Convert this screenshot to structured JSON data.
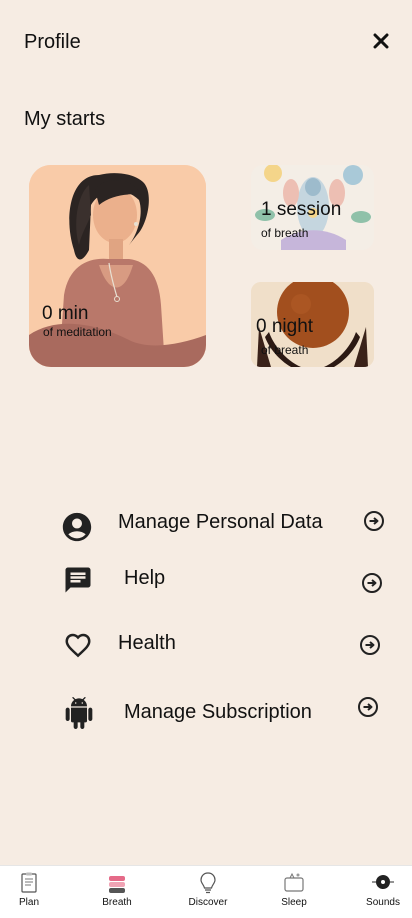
{
  "header": {
    "title": "Profile",
    "close_icon": "close-icon"
  },
  "stats_section": {
    "title": "My starts",
    "cards": [
      {
        "value": "0 min",
        "label": "of meditation"
      },
      {
        "value": "1 session",
        "label": "of breath"
      },
      {
        "value": "0 night",
        "label": "of breath"
      }
    ]
  },
  "menu": {
    "items": [
      {
        "label": "Manage Personal Data",
        "icon": "account-circle-icon"
      },
      {
        "label": "Help",
        "icon": "chat-icon"
      },
      {
        "label": "Health",
        "icon": "heart-icon"
      },
      {
        "label": "Manage Subscription",
        "icon": "android-icon"
      }
    ],
    "arrow_icon": "arrow-right-circle-icon"
  },
  "bottom_nav": {
    "items": [
      {
        "label": "Plan",
        "icon": "plan-icon"
      },
      {
        "label": "Breath",
        "icon": "breath-icon"
      },
      {
        "label": "Discover",
        "icon": "discover-icon"
      },
      {
        "label": "Sleep",
        "icon": "sleep-icon"
      },
      {
        "label": "Sounds",
        "icon": "sounds-icon"
      }
    ]
  },
  "colors": {
    "background": "#F6ECE3",
    "text": "#111111",
    "nav_background": "#FFFFFF"
  }
}
